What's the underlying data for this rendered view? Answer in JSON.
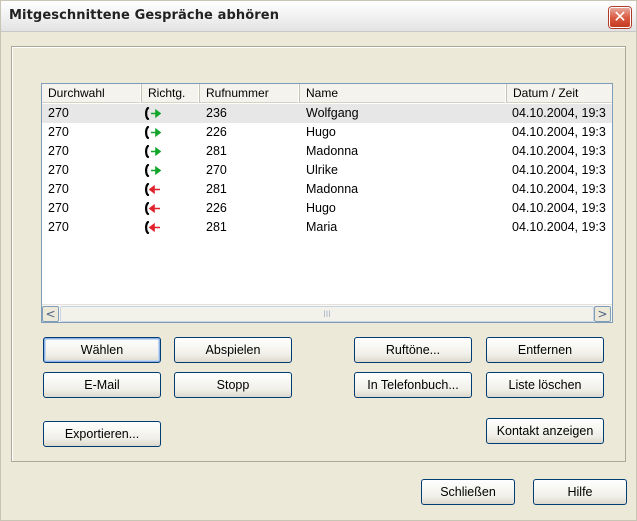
{
  "window": {
    "title": "Mitgeschnittene Gespräche abhören",
    "close_glyph": "✕"
  },
  "list": {
    "columns": [
      "Durchwahl",
      "Richtg.",
      "Rufnummer",
      "Name",
      "Datum / Zeit"
    ],
    "rows": [
      {
        "durchwahl": "270",
        "direction": "outgoing",
        "rufnummer": "236",
        "name": "Wolfgang",
        "datum": "04.10.2004, 19:3",
        "selected": true
      },
      {
        "durchwahl": "270",
        "direction": "outgoing",
        "rufnummer": "226",
        "name": "Hugo",
        "datum": "04.10.2004, 19:3"
      },
      {
        "durchwahl": "270",
        "direction": "outgoing",
        "rufnummer": "281",
        "name": "Madonna",
        "datum": "04.10.2004, 19:3"
      },
      {
        "durchwahl": "270",
        "direction": "outgoing",
        "rufnummer": "270",
        "name": "Ulrike",
        "datum": "04.10.2004, 19:3"
      },
      {
        "durchwahl": "270",
        "direction": "incoming",
        "rufnummer": "281",
        "name": "Madonna",
        "datum": "04.10.2004, 19:3"
      },
      {
        "durchwahl": "270",
        "direction": "incoming",
        "rufnummer": "226",
        "name": "Hugo",
        "datum": "04.10.2004, 19:3"
      },
      {
        "durchwahl": "270",
        "direction": "incoming",
        "rufnummer": "281",
        "name": "Maria",
        "datum": "04.10.2004, 19:3"
      }
    ],
    "direction_icons": {
      "outgoing": "phone-arrow-right-green-icon",
      "incoming": "phone-arrow-left-red-icon"
    },
    "scroll": {
      "left": "<",
      "right": ">",
      "thumb": "III"
    }
  },
  "buttons": {
    "waehlen": "Wählen",
    "abspielen": "Abspielen",
    "ruftoene": "Ruftöne...",
    "entfernen": "Entfernen",
    "email": "E-Mail",
    "stopp": "Stopp",
    "telefonbuch": "In Telefonbuch...",
    "liste_loeschen": "Liste löschen",
    "exportieren": "Exportieren...",
    "kontakt": "Kontakt anzeigen",
    "schliessen": "Schließen",
    "hilfe": "Hilfe"
  },
  "colors": {
    "outgoing": "#11a52a",
    "incoming": "#e0202a",
    "border": "#003c74"
  }
}
